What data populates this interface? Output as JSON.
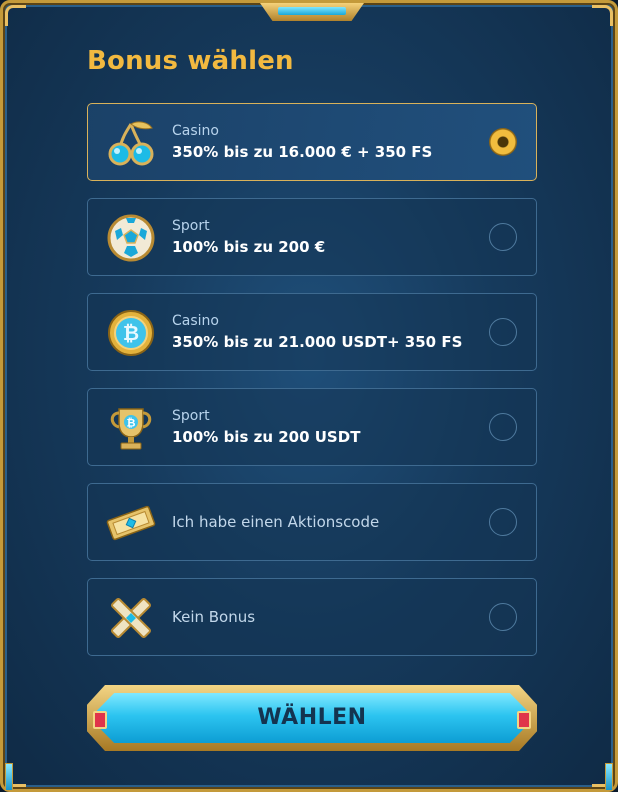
{
  "title": "Bonus wählen",
  "options": [
    {
      "kind": "Casino",
      "offer": "350% bis zu 16.000 € + 350 FS",
      "icon": "cherries-icon",
      "selected": true
    },
    {
      "kind": "Sport",
      "offer": "100% bis zu 200 €",
      "icon": "soccer-ball-icon",
      "selected": false
    },
    {
      "kind": "Casino",
      "offer": "350% bis zu 21.000 USDT+ 350 FS",
      "icon": "bitcoin-coin-icon",
      "selected": false
    },
    {
      "kind": "Sport",
      "offer": "100% bis zu 200 USDT",
      "icon": "trophy-icon",
      "selected": false
    },
    {
      "kind": "",
      "offer": "Ich habe einen Aktionscode",
      "icon": "ticket-icon",
      "selected": false
    },
    {
      "kind": "",
      "offer": "Kein Bonus",
      "icon": "x-cross-icon",
      "selected": false
    }
  ],
  "choose_button": "WÄHLEN",
  "colors": {
    "accent": "#f2b940",
    "background": "#163a5c",
    "button": "#2cc4f0"
  }
}
